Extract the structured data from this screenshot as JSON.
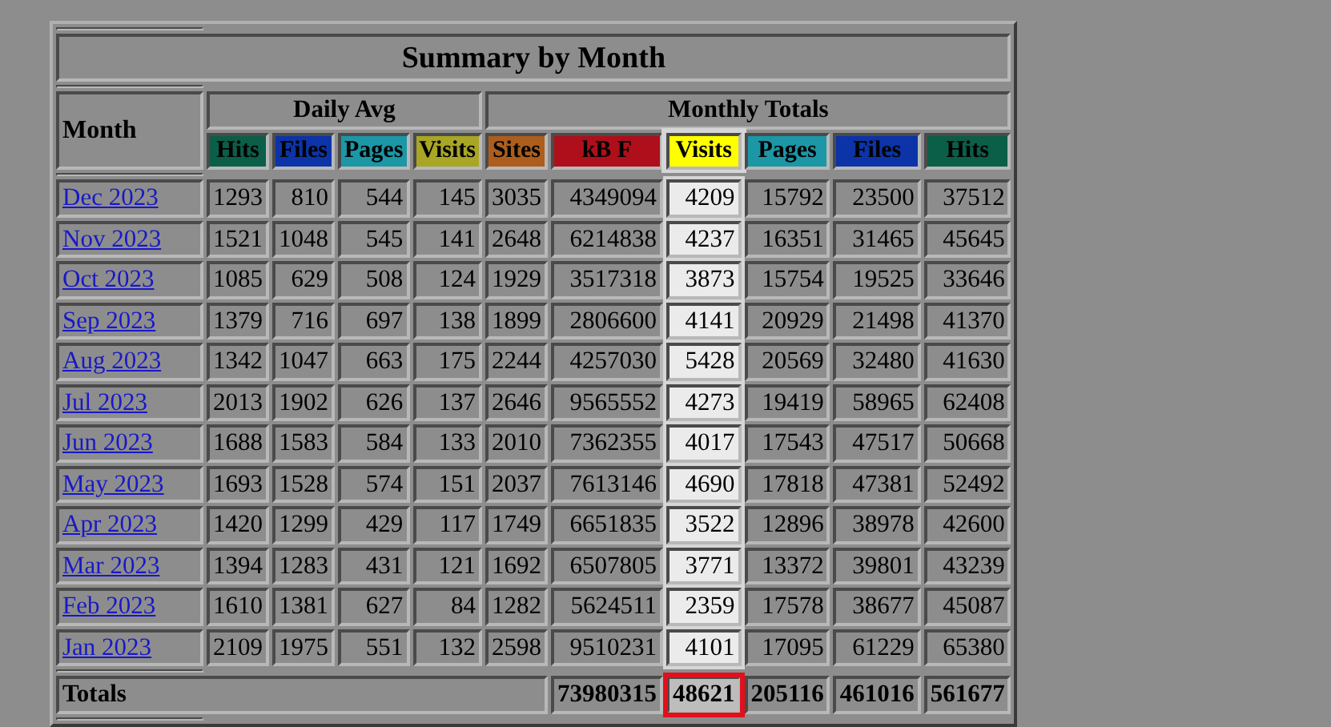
{
  "title": "Summary by Month",
  "month_header": "Month",
  "groups": [
    {
      "label": "Daily Avg"
    },
    {
      "label": "Monthly Totals"
    }
  ],
  "daily_columns": [
    {
      "label": "Hits",
      "color": "#0b5e48"
    },
    {
      "label": "Files",
      "color": "#0c34a8"
    },
    {
      "label": "Pages",
      "color": "#1b97a6"
    },
    {
      "label": "Visits",
      "color": "#a8a624"
    }
  ],
  "total_columns": [
    {
      "label": "Sites",
      "color": "#ad5e1c",
      "highlighted": false
    },
    {
      "label": "kB F",
      "color": "#ae0f1a",
      "highlighted": false
    },
    {
      "label": "Visits",
      "color": "#ffff00",
      "highlighted": true
    },
    {
      "label": "Pages",
      "color": "#1b97a6",
      "highlighted": false
    },
    {
      "label": "Files",
      "color": "#0c34a8",
      "highlighted": false
    },
    {
      "label": "Hits",
      "color": "#0b5e48",
      "highlighted": false
    }
  ],
  "rows": [
    {
      "month": "Dec 2023",
      "values": [
        "1293",
        "810",
        "544",
        "145",
        "3035",
        "4349094",
        "4209",
        "15792",
        "23500",
        "37512"
      ]
    },
    {
      "month": "Nov 2023",
      "values": [
        "1521",
        "1048",
        "545",
        "141",
        "2648",
        "6214838",
        "4237",
        "16351",
        "31465",
        "45645"
      ]
    },
    {
      "month": "Oct 2023",
      "values": [
        "1085",
        "629",
        "508",
        "124",
        "1929",
        "3517318",
        "3873",
        "15754",
        "19525",
        "33646"
      ]
    },
    {
      "month": "Sep 2023",
      "values": [
        "1379",
        "716",
        "697",
        "138",
        "1899",
        "2806600",
        "4141",
        "20929",
        "21498",
        "41370"
      ]
    },
    {
      "month": "Aug 2023",
      "values": [
        "1342",
        "1047",
        "663",
        "175",
        "2244",
        "4257030",
        "5428",
        "20569",
        "32480",
        "41630"
      ]
    },
    {
      "month": "Jul 2023",
      "values": [
        "2013",
        "1902",
        "626",
        "137",
        "2646",
        "9565552",
        "4273",
        "19419",
        "58965",
        "62408"
      ]
    },
    {
      "month": "Jun 2023",
      "values": [
        "1688",
        "1583",
        "584",
        "133",
        "2010",
        "7362355",
        "4017",
        "17543",
        "47517",
        "50668"
      ]
    },
    {
      "month": "May 2023",
      "values": [
        "1693",
        "1528",
        "574",
        "151",
        "2037",
        "7613146",
        "4690",
        "17818",
        "47381",
        "52492"
      ]
    },
    {
      "month": "Apr 2023",
      "values": [
        "1420",
        "1299",
        "429",
        "117",
        "1749",
        "6651835",
        "3522",
        "12896",
        "38978",
        "42600"
      ]
    },
    {
      "month": "Mar 2023",
      "values": [
        "1394",
        "1283",
        "431",
        "121",
        "1692",
        "6507805",
        "3771",
        "13372",
        "39801",
        "43239"
      ]
    },
    {
      "month": "Feb 2023",
      "values": [
        "1610",
        "1381",
        "627",
        "84",
        "1282",
        "5624511",
        "2359",
        "17578",
        "38677",
        "45087"
      ]
    },
    {
      "month": "Jan 2023",
      "values": [
        "2109",
        "1975",
        "551",
        "132",
        "2598",
        "9510231",
        "4101",
        "17095",
        "61229",
        "65380"
      ]
    }
  ],
  "totals": {
    "label": "Totals",
    "cells": [
      {
        "value": "73980315",
        "outlined": false
      },
      {
        "value": "48621",
        "outlined": true
      },
      {
        "value": "205116",
        "outlined": false
      },
      {
        "value": "461016",
        "outlined": false
      },
      {
        "value": "561677",
        "outlined": false
      }
    ]
  }
}
